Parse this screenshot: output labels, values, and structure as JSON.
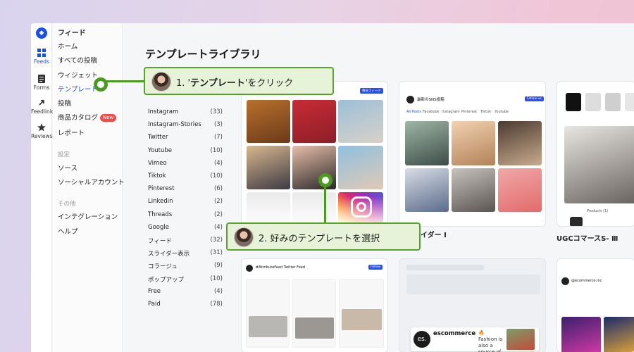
{
  "rail": {
    "items": [
      {
        "label": "Feeds",
        "icon": "grid-icon",
        "active": true
      },
      {
        "label": "Forms",
        "icon": "form-icon"
      },
      {
        "label": "Feedlink",
        "icon": "link-icon"
      },
      {
        "label": "Reviews",
        "icon": "star-icon"
      }
    ]
  },
  "sidebar": {
    "heading": "フィード",
    "items": [
      "ホーム",
      "すべての投稿",
      "ウィジェット",
      "テンプレート",
      "投稿",
      "商品カタログ",
      "レポート"
    ],
    "new_badge": "New",
    "settings_heading": "設定",
    "settings_items": [
      "ソース",
      "ソーシャルアカウント"
    ],
    "other_heading": "その他",
    "other_items": [
      "インテグレーション",
      "ヘルプ"
    ]
  },
  "main": {
    "title": "テンプレートライブラリ",
    "filters": [
      {
        "label": "Instagram",
        "count": "(33)"
      },
      {
        "label": "Instagram-Stories",
        "count": "(3)"
      },
      {
        "label": "Twitter",
        "count": "(7)"
      },
      {
        "label": "Youtube",
        "count": "(10)"
      },
      {
        "label": "Vimeo",
        "count": "(4)"
      },
      {
        "label": "Tiktok",
        "count": "(10)"
      },
      {
        "label": "Pinterest",
        "count": "(6)"
      },
      {
        "label": "Linkedin",
        "count": "(2)"
      },
      {
        "label": "Threads",
        "count": "(2)"
      },
      {
        "label": "Google",
        "count": "(4)"
      },
      {
        "label": "フィード",
        "count": "(32)"
      },
      {
        "label": "スライダー表示",
        "count": "(31)"
      },
      {
        "label": "コラージュ",
        "count": "(9)"
      },
      {
        "label": "ポップアップ",
        "count": "(10)"
      },
      {
        "label": "Free",
        "count": "(4)"
      },
      {
        "label": "Paid",
        "count": "(78)"
      }
    ],
    "cards": {
      "card1_button": "毎日フィード",
      "card2_header": "最新のSNS投稿",
      "card2_button": "Follow us",
      "card2_tabs": [
        "All Posts",
        "Facebook",
        "Instagram",
        "Pinterest",
        "Tiktok",
        "Youtube"
      ],
      "card2_caption": "イダー Ⅰ",
      "card3_caption": "UGCコマースS- Ⅲ",
      "card3_products": "Products (1)",
      "card4_header": "#AttributeFeed Twitter Feed",
      "card4_button": "Follow",
      "card5_brand": "escommerce",
      "card5_text": "🔥 Fashion is also a source of art, allowing...",
      "card6_header": "@ecommerce.inc",
      "card5_avatar": "es."
    }
  },
  "callouts": {
    "step1_prefix": "1. '",
    "step1_bold": "テンプレート",
    "step1_suffix": "'をクリック",
    "step2": "2. 好みのテンプレートを選択"
  },
  "colors": {
    "accent": "#1a4fe6",
    "callout_bg": "#e6f3d8",
    "callout_border": "#5aa02c",
    "badge": "#f04b4b"
  }
}
